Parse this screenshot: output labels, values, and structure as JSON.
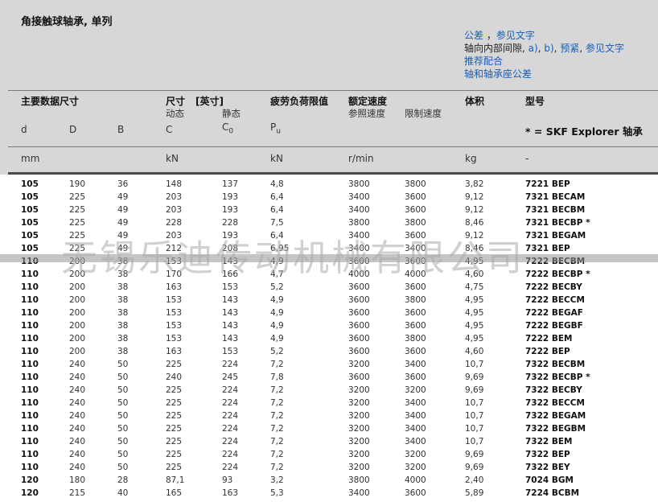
{
  "title": "角接触球轴承, 单列",
  "links": {
    "line1_link": "公差",
    "line1_rest_link": "参见文字",
    "line2_plain": "轴向内部间隙,",
    "line2_link1": "a)",
    "line2_link2": "b)",
    "line2_link3": "预紧",
    "line2_link4": "参见文字",
    "line3_link": "推荐配合",
    "line4_link": "轴和轴承座公差"
  },
  "table_header": {
    "main_dims": "主要数据尺寸",
    "size": "尺寸",
    "size_bracket": "[英寸]",
    "dynamic": "动态",
    "static": "静态",
    "fatigue": "疲劳负荷限值",
    "speed": "额定速度",
    "ref_speed": "参照速度",
    "limit_speed": "限制速度",
    "mass": "体积",
    "designation": "型号",
    "sym_d": "d",
    "sym_D": "D",
    "sym_B": "B",
    "sym_C": "C",
    "sym_C0_base": "C",
    "sym_C0_sub": "0",
    "sym_Pu_base": "P",
    "sym_Pu_sub": "u",
    "explorer_note": "* = SKF Explorer 轴承",
    "unit_mm": "mm",
    "unit_kN1": "kN",
    "unit_kN2": "kN",
    "unit_rmin": "r/min",
    "unit_kg": "kg",
    "unit_dash": "-"
  },
  "rows": [
    [
      "105",
      "190",
      "36",
      "148",
      "137",
      "4,8",
      "3800",
      "3800",
      "3,82",
      "7221 BEP"
    ],
    [
      "105",
      "225",
      "49",
      "203",
      "193",
      "6,4",
      "3400",
      "3600",
      "9,12",
      "7321 BECAM"
    ],
    [
      "105",
      "225",
      "49",
      "203",
      "193",
      "6,4",
      "3400",
      "3600",
      "9,12",
      "7321 BECBM"
    ],
    [
      "105",
      "225",
      "49",
      "228",
      "228",
      "7,5",
      "3800",
      "3800",
      "8,46",
      "7321 BECBP *"
    ],
    [
      "105",
      "225",
      "49",
      "203",
      "193",
      "6,4",
      "3400",
      "3600",
      "9,12",
      "7321 BEGAM"
    ],
    [
      "105",
      "225",
      "49",
      "212",
      "208",
      "6,95",
      "3400",
      "3400",
      "8,46",
      "7321 BEP"
    ],
    [
      "110",
      "200",
      "38",
      "153",
      "143",
      "4,9",
      "3600",
      "3600",
      "4,95",
      "7222 BECBM"
    ],
    [
      "110",
      "200",
      "38",
      "170",
      "166",
      "4,7",
      "4000",
      "4000",
      "4,60",
      "7222 BECBP *"
    ],
    [
      "110",
      "200",
      "38",
      "163",
      "153",
      "5,2",
      "3600",
      "3600",
      "4,75",
      "7222 BECBY"
    ],
    [
      "110",
      "200",
      "38",
      "153",
      "143",
      "4,9",
      "3600",
      "3800",
      "4,95",
      "7222 BECCM"
    ],
    [
      "110",
      "200",
      "38",
      "153",
      "143",
      "4,9",
      "3600",
      "3600",
      "4,95",
      "7222 BEGAF"
    ],
    [
      "110",
      "200",
      "38",
      "153",
      "143",
      "4,9",
      "3600",
      "3600",
      "4,95",
      "7222 BEGBF"
    ],
    [
      "110",
      "200",
      "38",
      "153",
      "143",
      "4,9",
      "3600",
      "3800",
      "4,95",
      "7222 BEM"
    ],
    [
      "110",
      "200",
      "38",
      "163",
      "153",
      "5,2",
      "3600",
      "3600",
      "4,60",
      "7222 BEP"
    ],
    [
      "110",
      "240",
      "50",
      "225",
      "224",
      "7,2",
      "3200",
      "3400",
      "10,7",
      "7322 BECBM"
    ],
    [
      "110",
      "240",
      "50",
      "240",
      "245",
      "7,8",
      "3600",
      "3600",
      "9,69",
      "7322 BECBP *"
    ],
    [
      "110",
      "240",
      "50",
      "225",
      "224",
      "7,2",
      "3200",
      "3200",
      "9,69",
      "7322 BECBY"
    ],
    [
      "110",
      "240",
      "50",
      "225",
      "224",
      "7,2",
      "3200",
      "3400",
      "10,7",
      "7322 BECCM"
    ],
    [
      "110",
      "240",
      "50",
      "225",
      "224",
      "7,2",
      "3200",
      "3400",
      "10,7",
      "7322 BEGAM"
    ],
    [
      "110",
      "240",
      "50",
      "225",
      "224",
      "7,2",
      "3200",
      "3400",
      "10,7",
      "7322 BEGBM"
    ],
    [
      "110",
      "240",
      "50",
      "225",
      "224",
      "7,2",
      "3200",
      "3400",
      "10,7",
      "7322 BEM"
    ],
    [
      "110",
      "240",
      "50",
      "225",
      "224",
      "7,2",
      "3200",
      "3200",
      "9,69",
      "7322 BEP"
    ],
    [
      "110",
      "240",
      "50",
      "225",
      "224",
      "7,2",
      "3200",
      "3200",
      "9,69",
      "7322 BEY"
    ],
    [
      "120",
      "180",
      "28",
      "87,1",
      "93",
      "3,2",
      "3800",
      "4000",
      "2,40",
      "7024 BGM"
    ],
    [
      "120",
      "215",
      "40",
      "165",
      "163",
      "5,3",
      "3400",
      "3600",
      "5,89",
      "7224 BCBM"
    ]
  ],
  "watermark": "无锡乐迪传动机械有限公司"
}
